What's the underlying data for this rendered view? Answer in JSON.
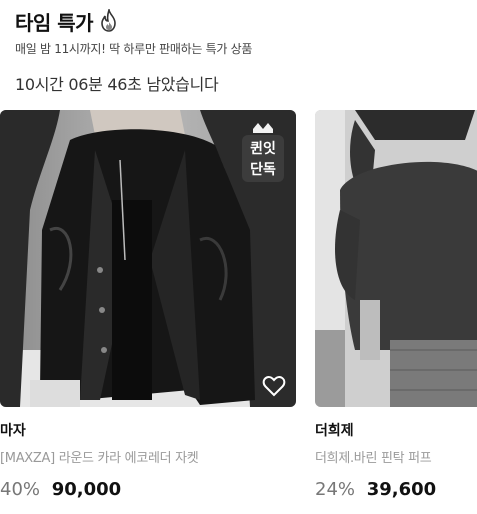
{
  "section": {
    "title": "타임 특가",
    "title_icon": "fire-icon",
    "subtitle": "매일 밤 11시까지! 딱 하루만 판매하는 특가 상품",
    "countdown": "10시간 06분 46초 남았습니다"
  },
  "products": [
    {
      "badge_line1": "퀸잇",
      "badge_line2": "단독",
      "brand": "마자",
      "name": "[MAXZA] 라운드 카라 에코레더 자켓",
      "discount": "40%",
      "price": "90,000",
      "wishlist_icon": "heart-outline-icon"
    },
    {
      "brand": "더희제",
      "name": "더희제.바린 핀탁 퍼프",
      "discount": "24%",
      "price": "39,600"
    }
  ],
  "colors": {
    "text": "#111111",
    "muted": "#9a9a9a",
    "discount": "#777777"
  }
}
